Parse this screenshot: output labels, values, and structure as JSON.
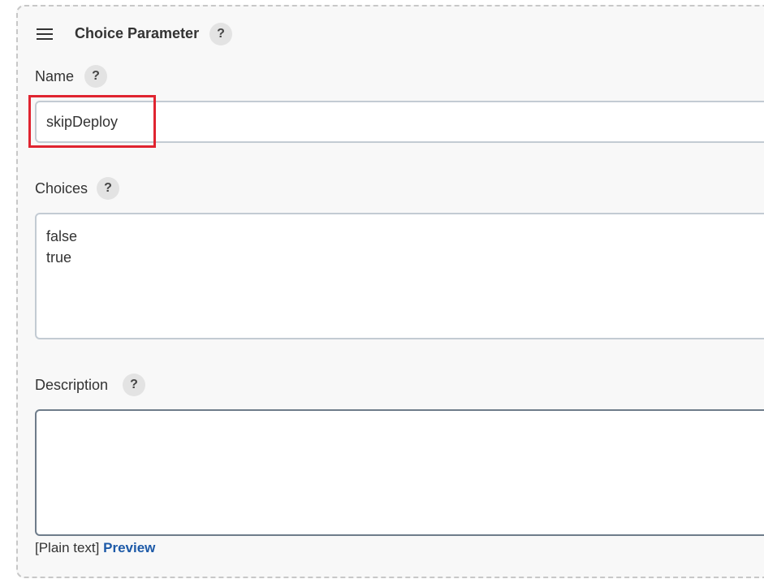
{
  "section": {
    "title": "Choice Parameter",
    "help": "?"
  },
  "name_field": {
    "label": "Name",
    "help": "?",
    "value": "skipDeploy"
  },
  "choices_field": {
    "label": "Choices",
    "help": "?",
    "lines": [
      "false",
      "true"
    ]
  },
  "description_field": {
    "label": "Description",
    "help": "?",
    "value": "",
    "format_text": "[Plain text]",
    "preview_link": "Preview"
  },
  "colors": {
    "highlight": "#e02430",
    "link": "#1d5aa8"
  }
}
